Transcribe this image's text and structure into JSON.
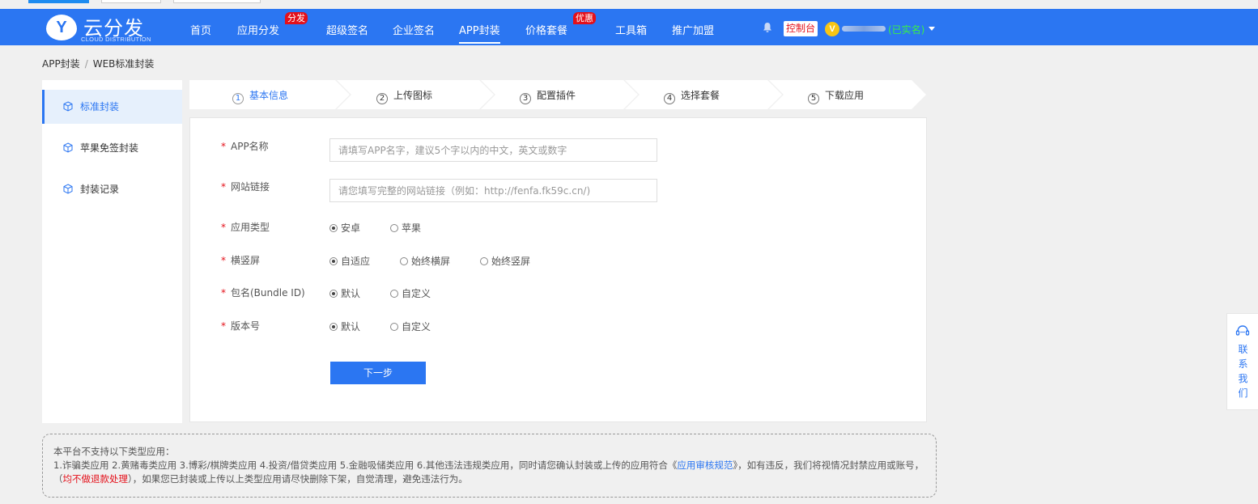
{
  "nav": {
    "logo_letter": "Y",
    "logo_title": "云分发",
    "logo_sub": "CLOUD DISTRIBUTION",
    "items": [
      {
        "label": "首页"
      },
      {
        "label": "应用分发",
        "badge": "分发"
      },
      {
        "label": "超级签名"
      },
      {
        "label": "企业签名"
      },
      {
        "label": "APP封装",
        "active": true
      },
      {
        "label": "价格套餐",
        "badge": "优惠"
      },
      {
        "label": "工具箱"
      },
      {
        "label": "推广加盟"
      }
    ],
    "console_label": "控制台",
    "vip_letter": "V",
    "verified_label": "(已实名)"
  },
  "breadcrumb": {
    "parent": "APP封装",
    "separator": "/",
    "current": "WEB标准封装"
  },
  "sidebar": {
    "items": [
      {
        "label": "标准封装",
        "active": true
      },
      {
        "label": "苹果免签封装"
      },
      {
        "label": "封装记录"
      }
    ]
  },
  "steps": [
    {
      "num": "1",
      "label": "基本信息",
      "active": true
    },
    {
      "num": "2",
      "label": "上传图标"
    },
    {
      "num": "3",
      "label": "配置插件"
    },
    {
      "num": "4",
      "label": "选择套餐"
    },
    {
      "num": "5",
      "label": "下载应用"
    }
  ],
  "form": {
    "app_name": {
      "label": "APP名称",
      "value": "",
      "placeholder": "请填写APP名字，建议5个字以内的中文，英文或数字"
    },
    "site_link": {
      "label": "网站链接",
      "value": "",
      "placeholder": "请您填写完整的网站链接（例如：http://fenfa.fk59c.cn/)"
    },
    "app_type": {
      "label": "应用类型",
      "options": [
        "安卓",
        "苹果"
      ],
      "selected": "安卓"
    },
    "orientation": {
      "label": "横竖屏",
      "options": [
        "自适应",
        "始终横屏",
        "始终竖屏"
      ],
      "selected": "自适应"
    },
    "bundle_id": {
      "label": "包名(Bundle ID)",
      "options": [
        "默认",
        "自定义"
      ],
      "selected": "默认"
    },
    "version": {
      "label": "版本号",
      "options": [
        "默认",
        "自定义"
      ],
      "selected": "默认"
    },
    "required_mark": "*",
    "next_label": "下一步"
  },
  "notice": {
    "line1": "本平台不支持以下类型应用：",
    "line2a": "1.诈骗类应用 2.黄赌毒类应用 3.博彩/棋牌类应用 4.投资/借贷类应用 5.金融吸储类应用 6.其他违法违规类应用，同时请您确认封装或上传的应用符合《",
    "link": "应用审核规范",
    "line2b": "》，如有违反，我们将视情况封禁应用或",
    "line3a": "账号，（",
    "red": "均不做退款处理",
    "line3b": "），如果您已封装或上传以上类型应用请尽快删除下架，自觉清理，避免违法行为。"
  },
  "contact": {
    "label": "联系我们",
    "chars": [
      "联",
      "系",
      "我",
      "们"
    ]
  },
  "colors": {
    "primary": "#2b76f2",
    "badge": "#e4101a",
    "verified": "#38f046",
    "vip": "#f8c514"
  }
}
